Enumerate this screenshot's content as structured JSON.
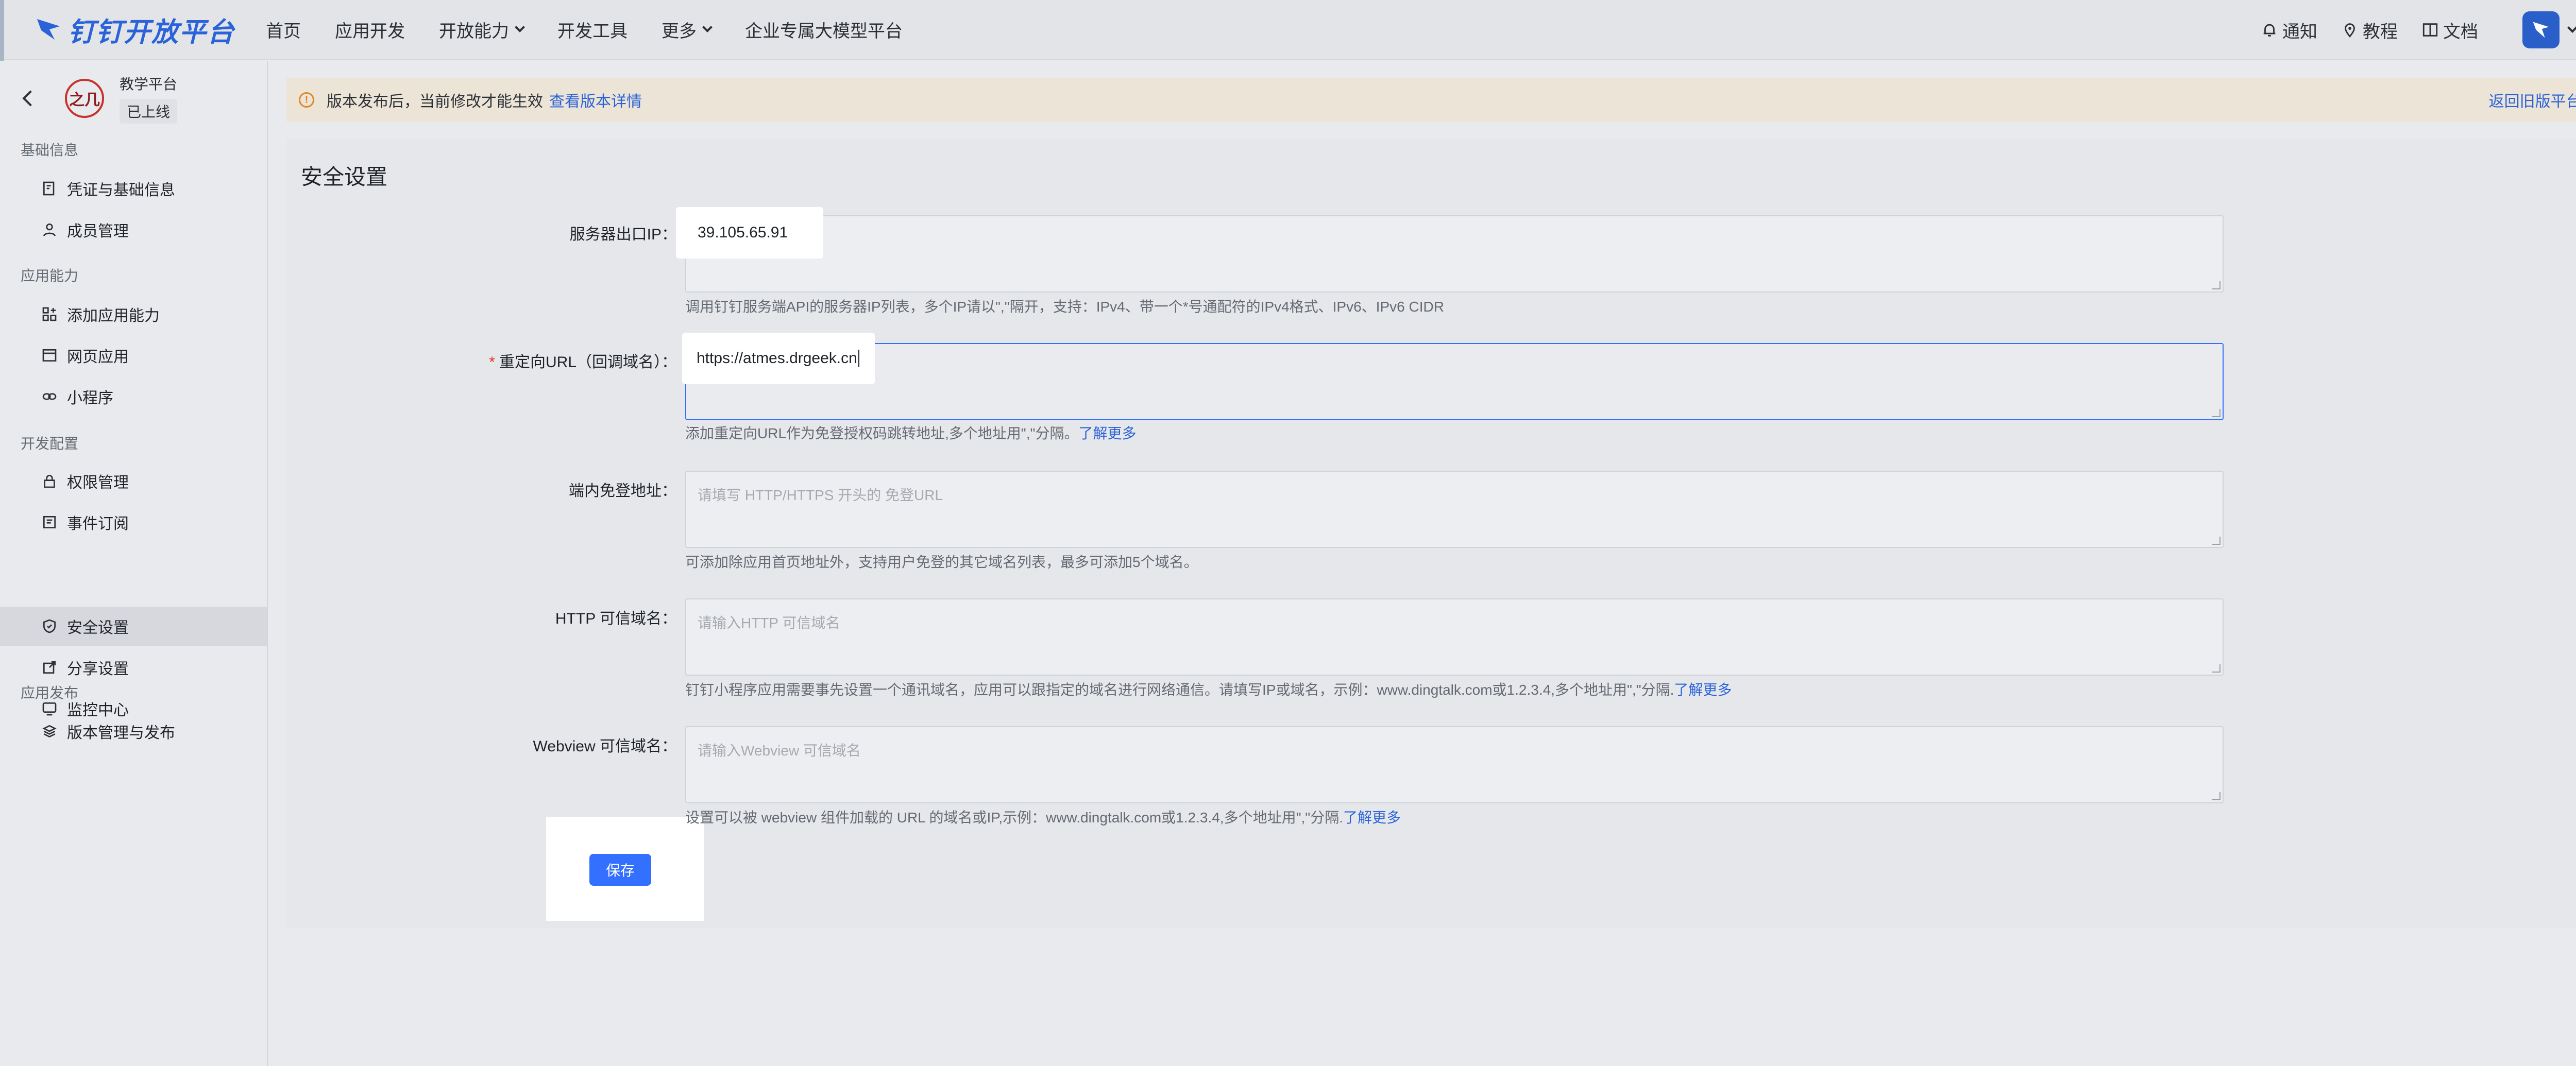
{
  "nav": {
    "brand": "钉钉开放平台",
    "items": [
      "首页",
      "应用开发",
      "开放能力",
      "开发工具",
      "更多",
      "企业专属大模型平台"
    ],
    "right": [
      "通知",
      "教程",
      "文档"
    ]
  },
  "app": {
    "logo_text": "之几",
    "name": "教学平台",
    "status": "已上线"
  },
  "sidebar": {
    "sections": [
      {
        "title": "基础信息",
        "items": [
          "凭证与基础信息",
          "成员管理"
        ]
      },
      {
        "title": "应用能力",
        "items": [
          "添加应用能力",
          "网页应用",
          "小程序"
        ]
      },
      {
        "title": "开发配置",
        "items": [
          "权限管理",
          "事件订阅",
          "安全设置",
          "分享设置",
          "监控中心"
        ]
      },
      {
        "title": "应用发布",
        "items": [
          "版本管理与发布"
        ]
      }
    ],
    "active": "安全设置"
  },
  "notice": {
    "text": "版本发布后，当前修改才能生效",
    "link": "查看版本详情",
    "back": "返回旧版平台"
  },
  "page": {
    "title": "安全设置",
    "fields": [
      {
        "label": "服务器出口IP：",
        "value": "39.105.65.91",
        "placeholder": "",
        "required": false,
        "hint": "调用钉钉服务端API的服务器IP列表，多个IP请以\",\"隔开，支持：IPv4、带一个*号通配符的IPv4格式、IPv6、IPv6 CIDR",
        "hint_link": ""
      },
      {
        "label": "重定向URL（回调域名）：",
        "value": "https://atmes.drgeek.cn",
        "placeholder": "",
        "required": true,
        "hint": "添加重定向URL作为免登授权码跳转地址,多个地址用\",\"分隔。",
        "hint_link": "了解更多"
      },
      {
        "label": "端内免登地址：",
        "value": "",
        "placeholder": "请填写 HTTP/HTTPS 开头的 免登URL",
        "required": false,
        "hint": "可添加除应用首页地址外，支持用户免登的其它域名列表，最多可添加5个域名。",
        "hint_link": ""
      },
      {
        "label": "HTTP 可信域名：",
        "value": "",
        "placeholder": "请输入HTTP 可信域名",
        "required": false,
        "hint": "钉钉小程序应用需要事先设置一个通讯域名，应用可以跟指定的域名进行网络通信。请填写IP或域名，示例：www.dingtalk.com或1.2.3.4,多个地址用\",\"分隔.",
        "hint_link": "了解更多"
      },
      {
        "label": "Webview 可信域名：",
        "value": "",
        "placeholder": "请输入Webview 可信域名",
        "required": false,
        "hint": "设置可以被 webview 组件加载的 URL 的域名或IP,示例：www.dingtalk.com或1.2.3.4,多个地址用\",\"分隔.",
        "hint_link": "了解更多"
      }
    ],
    "save_label": "保存"
  },
  "colors": {
    "accent": "#3370ff",
    "link": "#2a63d9",
    "required": "#d8372b",
    "warning": "#e0882a"
  }
}
